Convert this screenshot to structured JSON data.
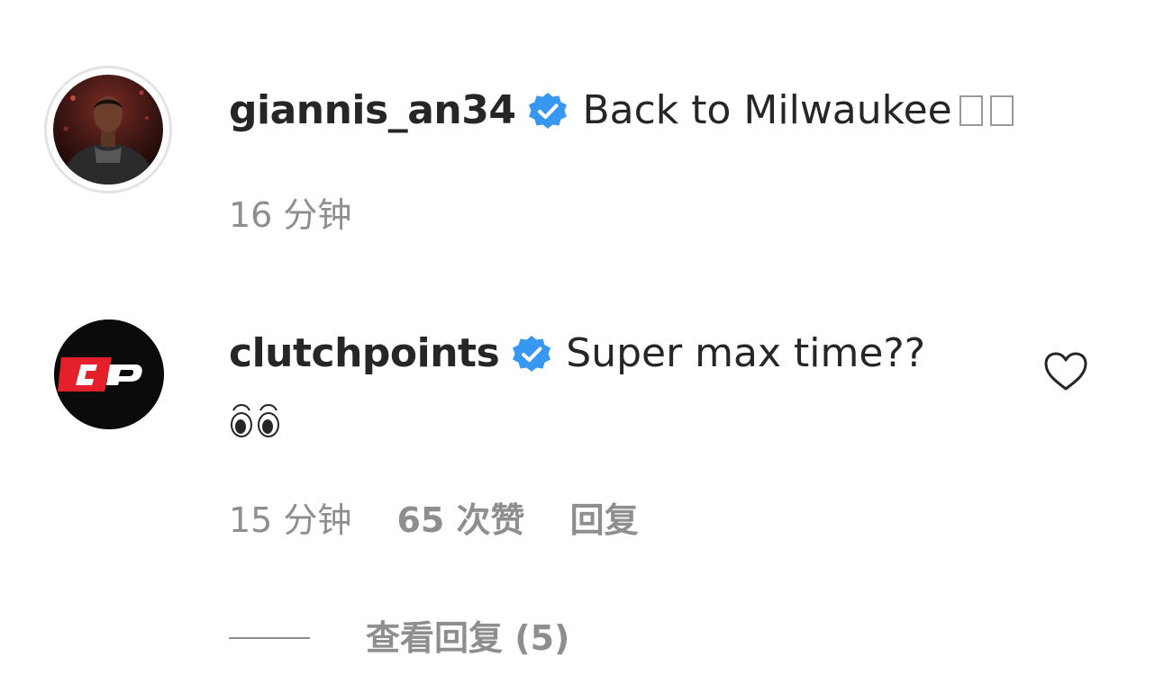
{
  "comments": [
    {
      "username": "giannis_an34",
      "verified": true,
      "text": "Back to Milwaukee",
      "trailing_glyphs": "missing-emoji-boxes",
      "time": "16 分钟"
    },
    {
      "username": "clutchpoints",
      "verified": true,
      "text": "Super max time??",
      "emoji": "eyes",
      "avatar_logo_text": "CP",
      "time": "15 分钟",
      "likes": "65 次赞",
      "reply_label": "回复",
      "view_replies_label": "查看回复 (5)"
    }
  ],
  "colors": {
    "username": "#262626",
    "meta_gray": "#8e8e8e",
    "verified_blue": "#3897f0",
    "cp_red": "#e4202a",
    "cp_black": "#0b0b0b"
  },
  "icons": {
    "verified": "verified-badge-icon",
    "like": "heart-outline-icon",
    "emoji": "eyes-emoji-icon"
  }
}
